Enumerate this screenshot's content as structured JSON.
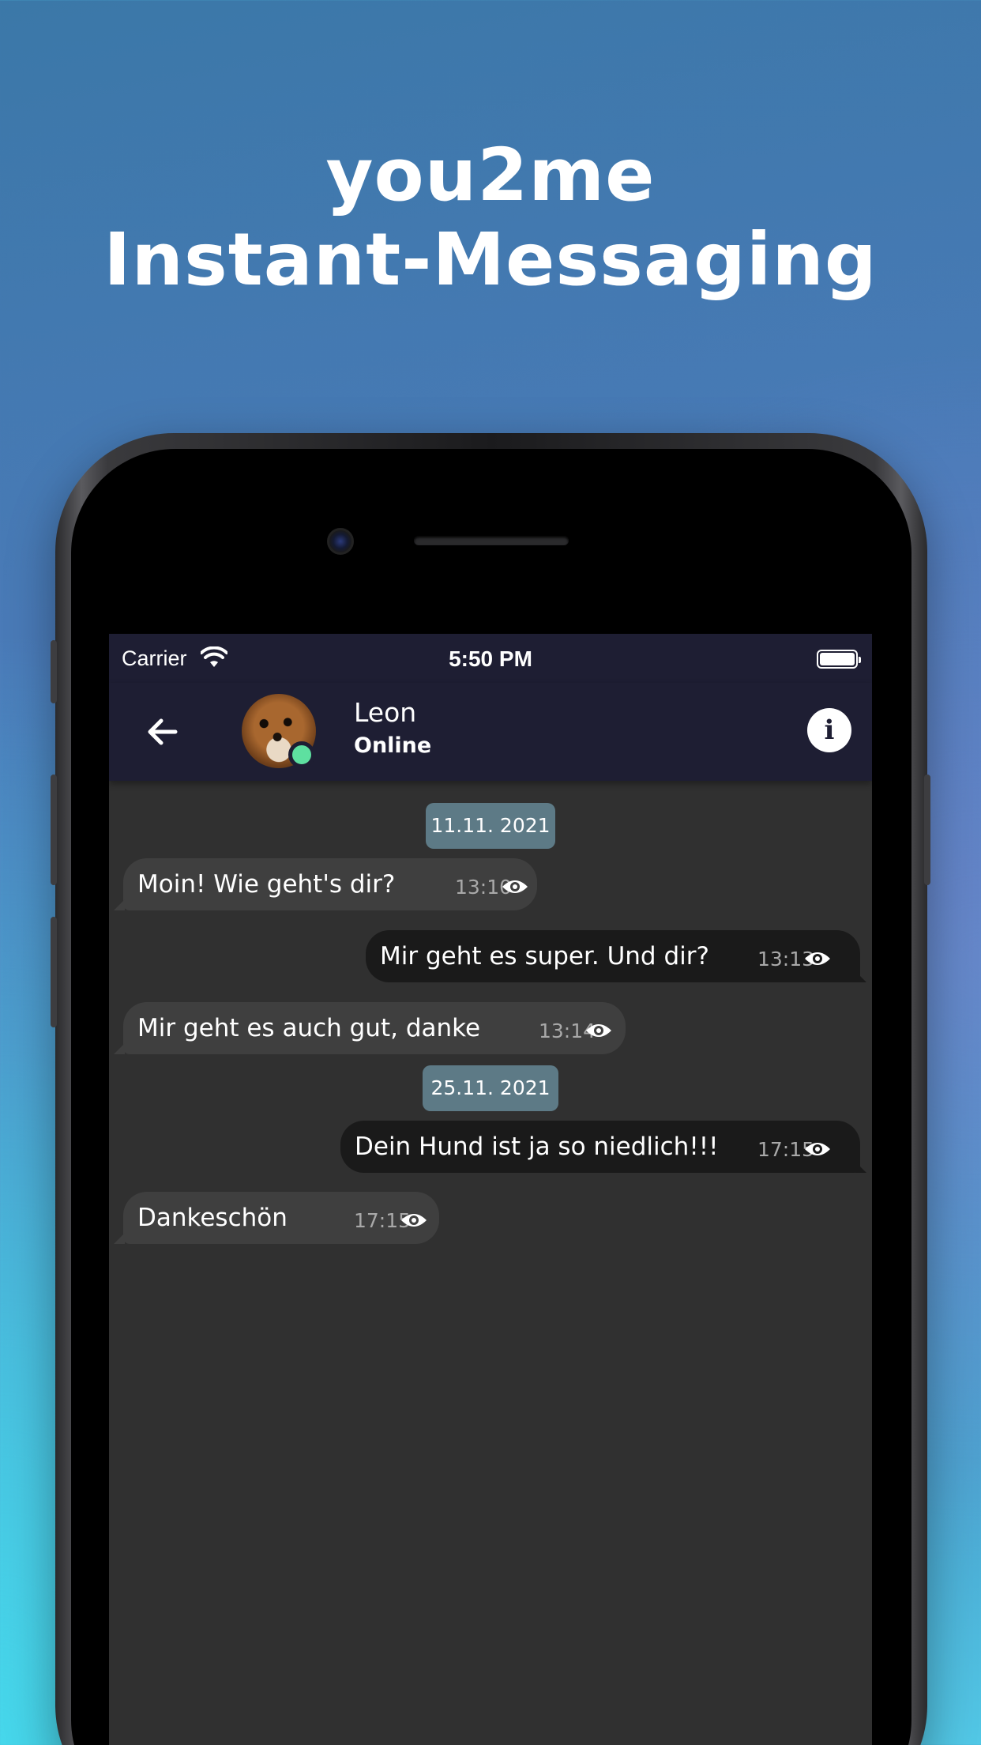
{
  "headline": {
    "line1": "you2me",
    "line2": "Instant-Messaging"
  },
  "status_bar": {
    "carrier": "Carrier",
    "time": "5:50 PM"
  },
  "app_bar": {
    "contact_name": "Leon",
    "contact_status": "Online",
    "info_glyph": "i"
  },
  "colors": {
    "bar_bg": "#1e1e33",
    "chat_bg": "#303030",
    "incoming_bubble": "#3f3f3f",
    "outgoing_bubble": "#1a1a1a",
    "date_chip": "#5d7a86",
    "online": "#5ee0a0"
  },
  "conversation": {
    "dates": [
      "11.11. 2021",
      "25.11. 2021"
    ],
    "messages": [
      {
        "direction": "incoming",
        "text": "Moin! Wie geht's dir?",
        "time": "13:10",
        "status_icon": "eye-icon"
      },
      {
        "direction": "outgoing",
        "text": "Mir geht es super. Und dir?",
        "time": "13:13",
        "status_icon": "eye-icon"
      },
      {
        "direction": "incoming",
        "text": "Mir geht es auch gut, danke",
        "time": "13:14",
        "status_icon": "eye-icon"
      },
      {
        "direction": "outgoing",
        "text": "Dein Hund ist ja so niedlich!!!",
        "time": "17:15",
        "status_icon": "eye-icon"
      },
      {
        "direction": "incoming",
        "text": "Dankeschön",
        "time": "17:15",
        "status_icon": "eye-icon"
      }
    ]
  }
}
